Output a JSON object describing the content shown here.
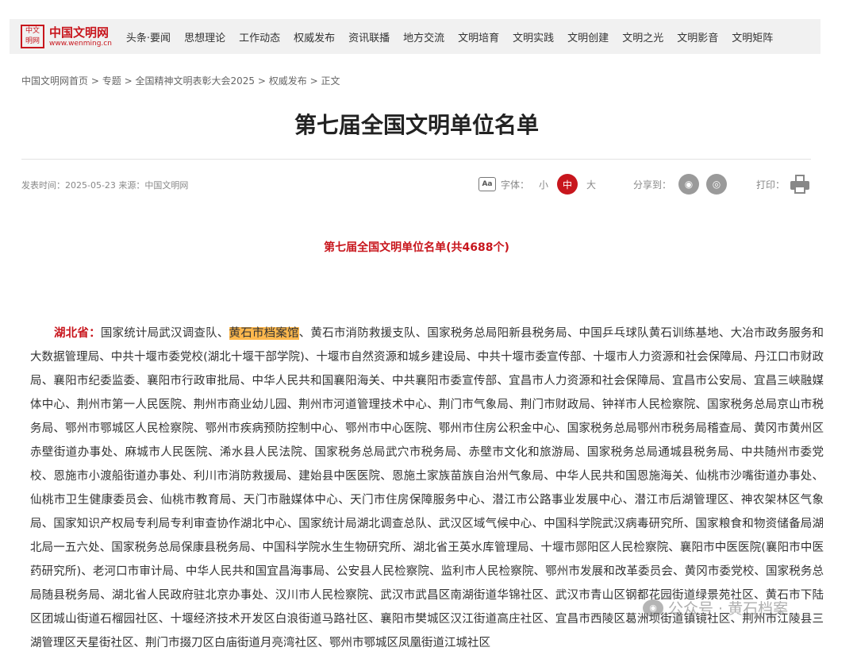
{
  "header": {
    "logo_seal_top": "中文",
    "logo_seal_bottom": "明网",
    "logo_name": "中国文明网",
    "logo_url": "www.wenming.cn",
    "nav": [
      "头条·要闻",
      "思想理论",
      "工作动态",
      "权威发布",
      "资讯联播",
      "地方交流",
      "文明培育",
      "文明实践",
      "文明创建",
      "文明之光",
      "文明影音",
      "文明矩阵"
    ]
  },
  "breadcrumb": {
    "items": [
      "中国文明网首页",
      "专题",
      "全国精神文明表彰大会2025",
      "权威发布",
      "正文"
    ],
    "separator": ">"
  },
  "article": {
    "title": "第七届全国文明单位名单",
    "meta": "发表时间：2025-05-23 来源：中国文明网",
    "font_label": "字体：",
    "font_small": "小",
    "font_medium": "中",
    "font_large": "大",
    "share_label": "分享到：",
    "print_label": "打印：",
    "subtitle": "第七届全国文明单位名单(共4688个)",
    "province": "湖北省：",
    "highlight": "黄石市档案馆",
    "body_prefix": "国家统计局武汉调查队、",
    "body_rest": "、黄石市消防救援支队、国家税务总局阳新县税务局、中国乒乓球队黄石训练基地、大冶市政务服务和大数据管理局、中共十堰市委党校(湖北十堰干部学院)、十堰市自然资源和城乡建设局、中共十堰市委宣传部、十堰市人力资源和社会保障局、丹江口市财政局、襄阳市纪委监委、襄阳市行政审批局、中华人民共和国襄阳海关、中共襄阳市委宣传部、宜昌市人力资源和社会保障局、宜昌市公安局、宜昌三峡融媒体中心、荆州市第一人民医院、荆州市商业幼儿园、荆州市河道管理技术中心、荆门市气象局、荆门市财政局、钟祥市人民检察院、国家税务总局京山市税务局、鄂州市鄂城区人民检察院、鄂州市疾病预防控制中心、鄂州市中心医院、鄂州市住房公积金中心、国家税务总局鄂州市税务局稽查局、黄冈市黄州区赤壁街道办事处、麻城市人民医院、浠水县人民法院、国家税务总局武穴市税务局、赤壁市文化和旅游局、国家税务总局通城县税务局、中共随州市委党校、恩施市小渡船街道办事处、利川市消防救援局、建始县中医医院、恩施土家族苗族自治州气象局、中华人民共和国恩施海关、仙桃市沙嘴街道办事处、仙桃市卫生健康委员会、仙桃市教育局、天门市融媒体中心、天门市住房保障服务中心、潜江市公路事业发展中心、潜江市后湖管理区、神农架林区气象局、国家知识产权局专利局专利审查协作湖北中心、国家统计局湖北调查总队、武汉区域气候中心、中国科学院武汉病毒研究所、国家粮食和物资储备局湖北局一五六处、国家税务总局保康县税务局、中国科学院水生生物研究所、湖北省王英水库管理局、十堰市郧阳区人民检察院、襄阳市中医医院(襄阳市中医药研究所)、老河口市审计局、中华人民共和国宜昌海事局、公安县人民检察院、监利市人民检察院、鄂州市发展和改革委员会、黄冈市委党校、国家税务总局随县税务局、湖北省人民政府驻北京办事处、汉川市人民检察院、武汉市武昌区南湖街道华锦社区、武汉市青山区钢都花园街道绿景苑社区、黄石市下陆区团城山街道石榴园社区、十堰经济技术开发区白浪街道马路社区、襄阳市樊城区汉江街道高庄社区、宜昌市西陵区葛洲坝街道镇镜社区、荆州市江陵县三湖管理区天星街社区、荆门市掇刀区白庙街道月亮湾社区、鄂州市鄂城区凤凰街道江城社区"
  },
  "watermark": {
    "icon": "wechat-icon",
    "text": "公众号 · 黄石档案"
  }
}
